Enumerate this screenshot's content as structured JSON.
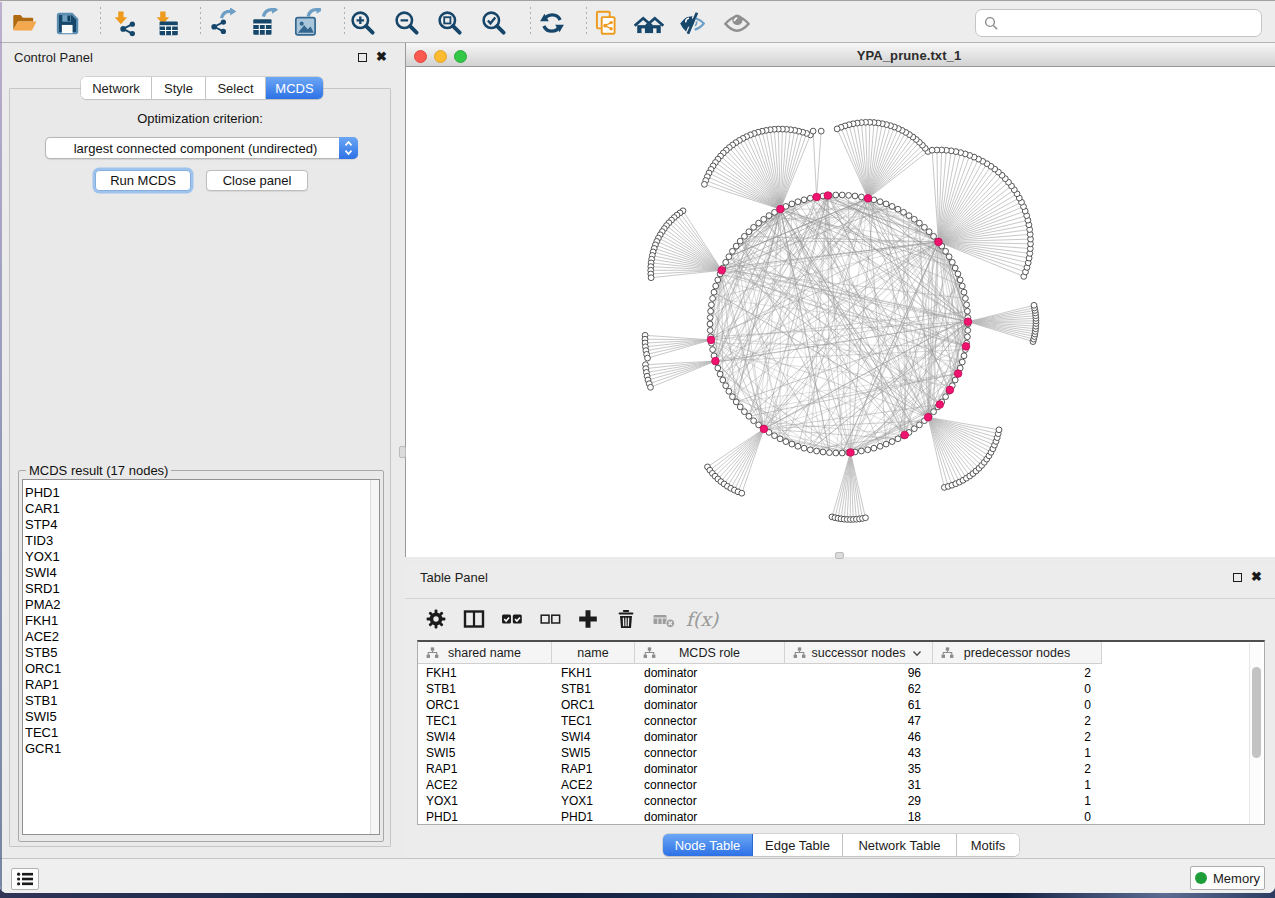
{
  "toolbar": {
    "icons": [
      "open-file",
      "save-session",
      "import-network",
      "import-table",
      "export-network",
      "export-table",
      "export-image",
      "zoom-in",
      "zoom-out",
      "zoom-fit",
      "zoom-selected",
      "refresh",
      "clone-network",
      "show-all",
      "hide-selected",
      "show-hidden"
    ],
    "search": {
      "value": "",
      "placeholder": ""
    }
  },
  "control_panel": {
    "title": "Control Panel",
    "tabs": [
      {
        "label": "Network",
        "active": false
      },
      {
        "label": "Style",
        "active": false
      },
      {
        "label": "Select",
        "active": false
      },
      {
        "label": "MCDS",
        "active": true
      }
    ],
    "optimization_label": "Optimization criterion:",
    "dropdown_value": "largest connected component (undirected)",
    "run_button": "Run MCDS",
    "close_button": "Close panel",
    "result_title": "MCDS result (17 nodes)",
    "result_nodes": [
      "PHD1",
      "CAR1",
      "STP4",
      "TID3",
      "YOX1",
      "SWI4",
      "SRD1",
      "PMA2",
      "FKH1",
      "ACE2",
      "STB5",
      "ORC1",
      "RAP1",
      "STB1",
      "SWI5",
      "TEC1",
      "GCR1"
    ]
  },
  "network_window": {
    "title": "YPA_prune.txt_1"
  },
  "table_panel": {
    "title": "Table Panel",
    "columns": [
      {
        "label": "shared name",
        "shared": true,
        "width": 134,
        "align": "left"
      },
      {
        "label": "name",
        "shared": false,
        "width": 83,
        "align": "left"
      },
      {
        "label": "MCDS role",
        "shared": true,
        "width": 150,
        "align": "left"
      },
      {
        "label": "successor nodes",
        "shared": true,
        "width": 148,
        "align": "right",
        "sort": "desc"
      },
      {
        "label": "predecessor nodes",
        "shared": true,
        "width": 169,
        "align": "right"
      }
    ],
    "rows": [
      [
        "FKH1",
        "FKH1",
        "dominator",
        96,
        2
      ],
      [
        "STB1",
        "STB1",
        "dominator",
        62,
        0
      ],
      [
        "ORC1",
        "ORC1",
        "dominator",
        61,
        0
      ],
      [
        "TEC1",
        "TEC1",
        "connector",
        47,
        2
      ],
      [
        "SWI4",
        "SWI4",
        "dominator",
        46,
        2
      ],
      [
        "SWI5",
        "SWI5",
        "connector",
        43,
        1
      ],
      [
        "RAP1",
        "RAP1",
        "dominator",
        35,
        2
      ],
      [
        "ACE2",
        "ACE2",
        "connector",
        31,
        1
      ],
      [
        "YOX1",
        "YOX1",
        "connector",
        29,
        1
      ],
      [
        "PHD1",
        "PHD1",
        "dominator",
        18,
        0
      ]
    ],
    "tabs": [
      {
        "label": "Node Table",
        "active": true
      },
      {
        "label": "Edge Table",
        "active": false
      },
      {
        "label": "Network Table",
        "active": false
      },
      {
        "label": "Motifs",
        "active": false
      }
    ]
  },
  "status_bar": {
    "memory_label": "Memory"
  },
  "colors": {
    "accent_blue": "#2d71e6",
    "hub_pink": "#f0146e",
    "icon_navy": "#17466b",
    "icon_orange": "#ee9a1c",
    "icon_steel": "#6d9fc6"
  },
  "chart_data": {
    "type": "network",
    "title": "YPA_prune.txt_1",
    "layout": "degree-sorted-circle",
    "center": [
      433,
      256
    ],
    "ring_radius": 129,
    "ring_count": 126,
    "node_radius": 2.9,
    "hub_radius": 3.8,
    "seed": 11,
    "extra_chords": 20,
    "hubs": [
      {
        "angle": 117,
        "chords": 34,
        "fan": {
          "count": 33,
          "r": 80,
          "a0": 68,
          "a1": 162
        }
      },
      {
        "angle": 100,
        "chords": 12,
        "fan": {
          "count": 2,
          "r": 66,
          "a0": 86,
          "a1": 93
        }
      },
      {
        "angle": 95,
        "chords": 18,
        "fan": null
      },
      {
        "angle": 77,
        "chords": 26,
        "fan": {
          "count": 25,
          "r": 76,
          "a0": 38,
          "a1": 114
        }
      },
      {
        "angle": 39.5,
        "chords": 46,
        "fan": {
          "count": 40,
          "r": 92,
          "a0": -22,
          "a1": 94
        }
      },
      {
        "angle": 1,
        "chords": 25,
        "fan": {
          "count": 15,
          "r": 68,
          "a0": -17,
          "a1": 14
        }
      },
      {
        "angle": -10,
        "chords": 10,
        "fan": null
      },
      {
        "angle": -22.6,
        "chords": 10,
        "fan": null
      },
      {
        "angle": -30.7,
        "chords": 8,
        "fan": null
      },
      {
        "angle": -38.6,
        "chords": 8,
        "fan": null
      },
      {
        "angle": -46.3,
        "chords": 24,
        "fan": {
          "count": 22,
          "r": 72,
          "a0": -77,
          "a1": -10
        }
      },
      {
        "angle": -59.4,
        "chords": 14,
        "fan": null
      },
      {
        "angle": -84.9,
        "chords": 22,
        "fan": {
          "count": 12,
          "r": 67,
          "a0": -106,
          "a1": -77
        }
      },
      {
        "angle": -125.6,
        "chords": 22,
        "fan": {
          "count": 12,
          "r": 68,
          "a0": -146,
          "a1": -109
        }
      },
      {
        "angle": -163.3,
        "chords": 12,
        "fan": {
          "count": 7,
          "r": 70,
          "a0": -177,
          "a1": -158
        }
      },
      {
        "angle": -172.9,
        "chords": 12,
        "fan": {
          "count": 7,
          "r": 66,
          "a0": 176,
          "a1": 196
        }
      },
      {
        "angle": 155.4,
        "chords": 22,
        "fan": {
          "count": 22,
          "r": 71,
          "a0": 123,
          "a1": 186
        }
      }
    ]
  }
}
